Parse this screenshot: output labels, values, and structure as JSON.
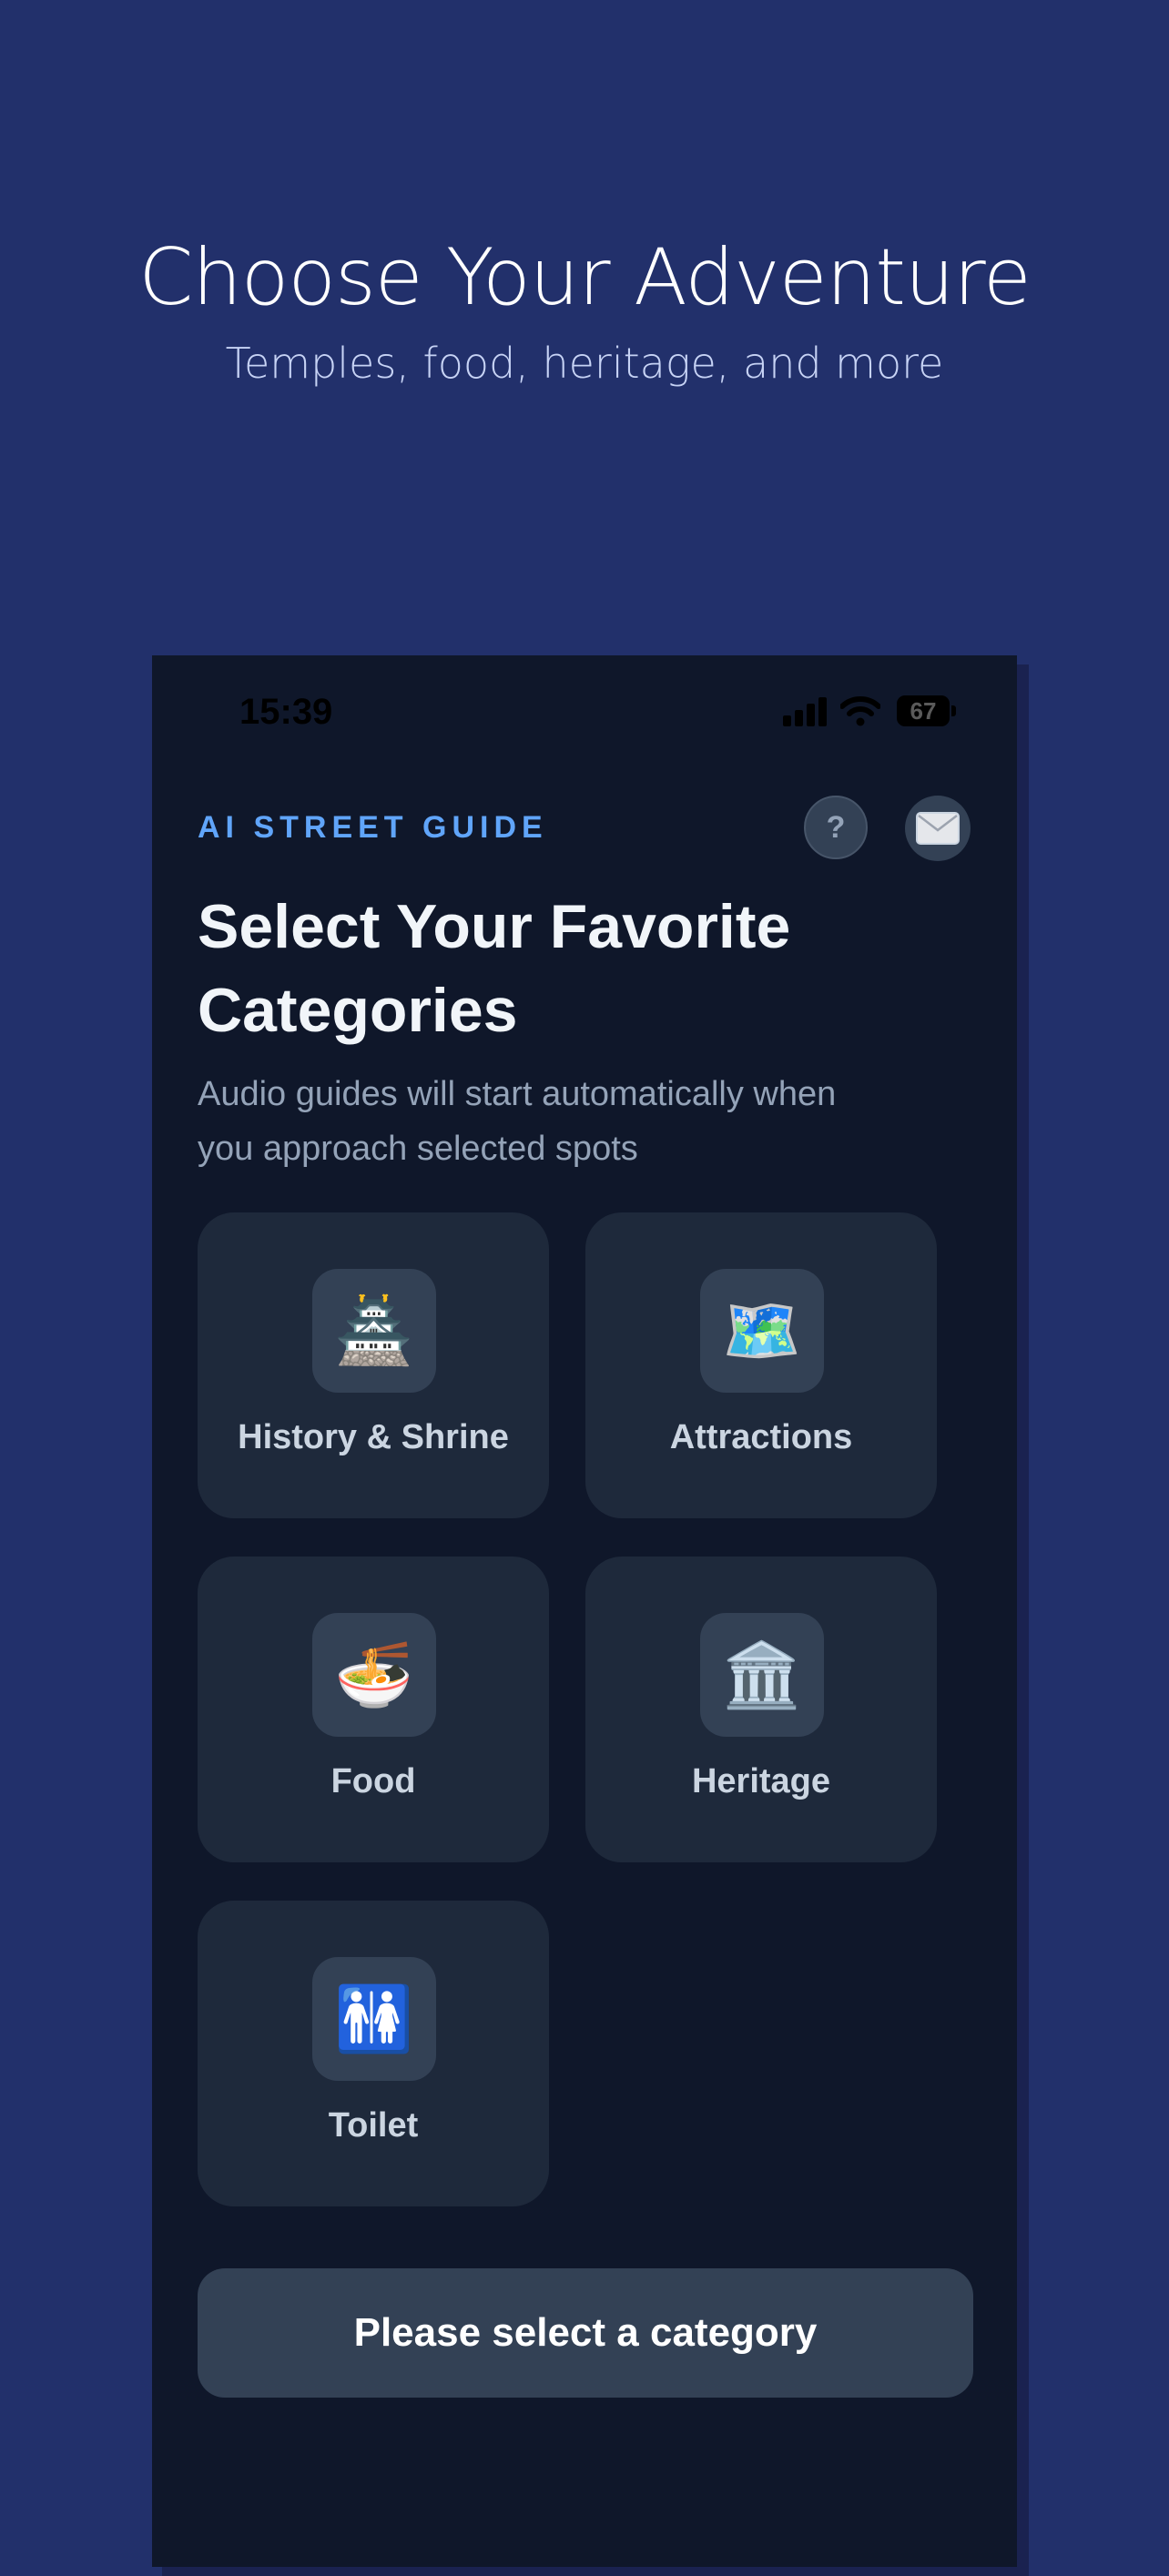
{
  "promo": {
    "title": "Choose Your Adventure",
    "subtitle": "Temples, food, heritage, and more"
  },
  "status_bar": {
    "time": "15:39",
    "battery": "67"
  },
  "header": {
    "brand": "AI STREET GUIDE",
    "help_label": "?",
    "help_icon": "question-icon",
    "mail_icon": "envelope-icon"
  },
  "main": {
    "title": "Select Your Favorite Categories",
    "description": "Audio guides will start automatically when you approach selected spots"
  },
  "categories": [
    {
      "label": "History & Shrine",
      "icon": "🏯",
      "icon_name": "castle-icon"
    },
    {
      "label": "Attractions",
      "icon": "🗺️",
      "icon_name": "map-icon"
    },
    {
      "label": "Food",
      "icon": "🍜",
      "icon_name": "noodle-bowl-icon"
    },
    {
      "label": "Heritage",
      "icon": "🏛️",
      "icon_name": "classical-building-icon"
    },
    {
      "label": "Toilet",
      "icon": "🚻",
      "icon_name": "restroom-icon"
    }
  ],
  "cta": {
    "label": "Please select a category"
  },
  "colors": {
    "background": "#22306b",
    "phone_background": "#0f172a",
    "card": "#1e293b",
    "accent": "#60a5fa"
  }
}
